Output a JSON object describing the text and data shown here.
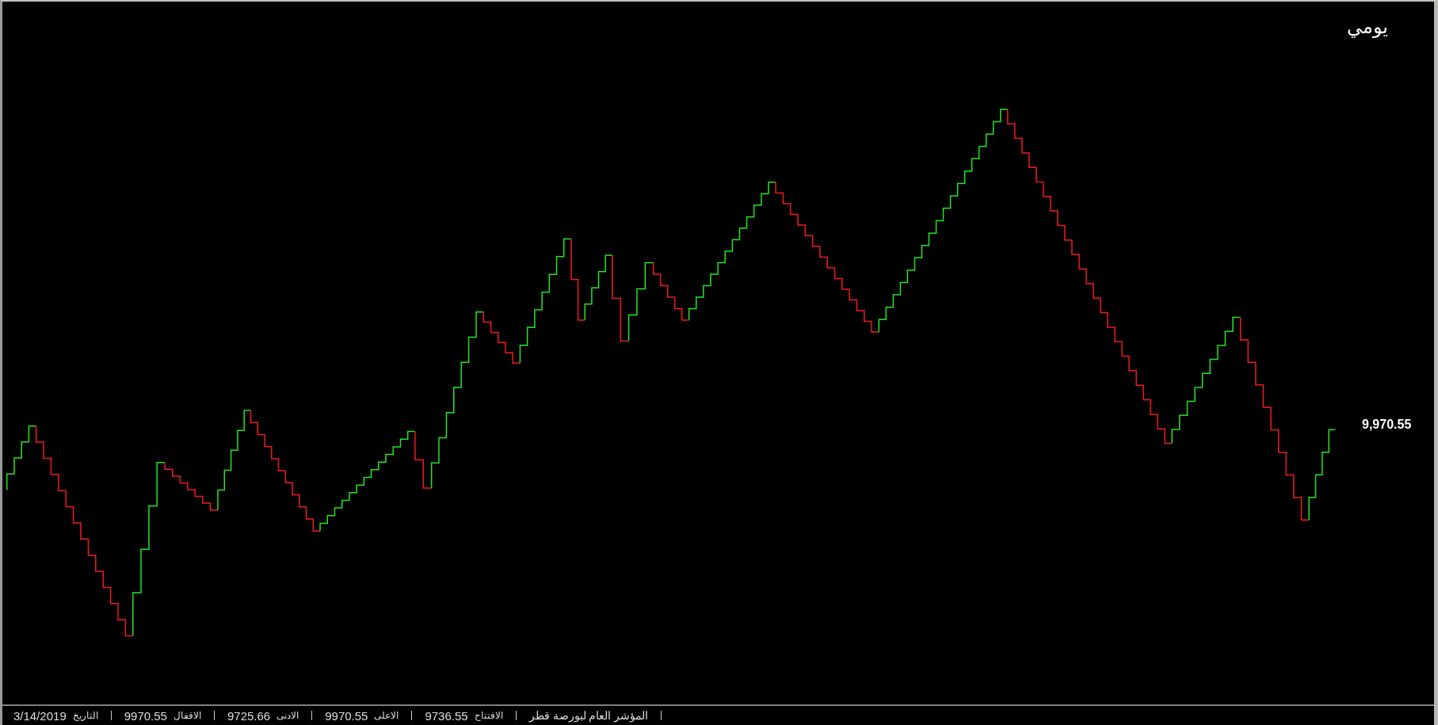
{
  "chart": {
    "period": "يومي",
    "last_value": "9,970.55"
  },
  "status_bar": {
    "title": "المؤشر العام لبورصة قطر",
    "fields": [
      {
        "label": "الافتتاح",
        "value": "9736.55"
      },
      {
        "label": "الاعلى",
        "value": "9970.55"
      },
      {
        "label": "الادنى",
        "value": "9725.66"
      },
      {
        "label": "الاقفال",
        "value": "9970.55"
      },
      {
        "label": "التاريخ",
        "value": "3/14/2019"
      }
    ]
  }
}
